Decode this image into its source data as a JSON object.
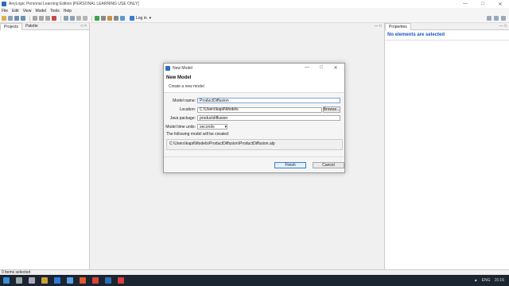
{
  "window": {
    "title": "AnyLogic Personal Learning Edition [PERSONAL LEARNING USE ONLY]"
  },
  "menu": [
    "File",
    "Edit",
    "View",
    "Model",
    "Tools",
    "Help"
  ],
  "toolbar": {
    "login_label": "Log in"
  },
  "left_panel": {
    "tabs": [
      "Projects",
      "Palette"
    ],
    "controls": "□ ×"
  },
  "right_panel": {
    "tab": "Properties",
    "message": "No elements are selected"
  },
  "status_bar": {
    "text": "0 items selected"
  },
  "dialog": {
    "title": "New Model",
    "heading": "New Model",
    "subtitle": "Create a new model",
    "fields": {
      "model_name_label": "Model name:",
      "model_name_value": "ProductDiffusion",
      "location_label": "Location:",
      "location_value": "C:\\Users\\kapil\\Models",
      "browse_label": "Browse...",
      "java_package_label": "Java package:",
      "java_package_value": "productdiffusion",
      "time_units_label": "Model time units:",
      "time_units_value": "seconds"
    },
    "info_text": "The following model will be created:",
    "created_path": "C:\\Users\\kapil\\Models\\ProductDiffusion\\ProductDiffusion.alp",
    "finish_label": "Finish",
    "cancel_label": "Cancel"
  },
  "taskbar": {
    "language": "ENG",
    "time": "15:16"
  },
  "colors": {
    "accent": "#1a55c7",
    "taskbar": "#1c2430",
    "logo": "#2a6fb8"
  }
}
